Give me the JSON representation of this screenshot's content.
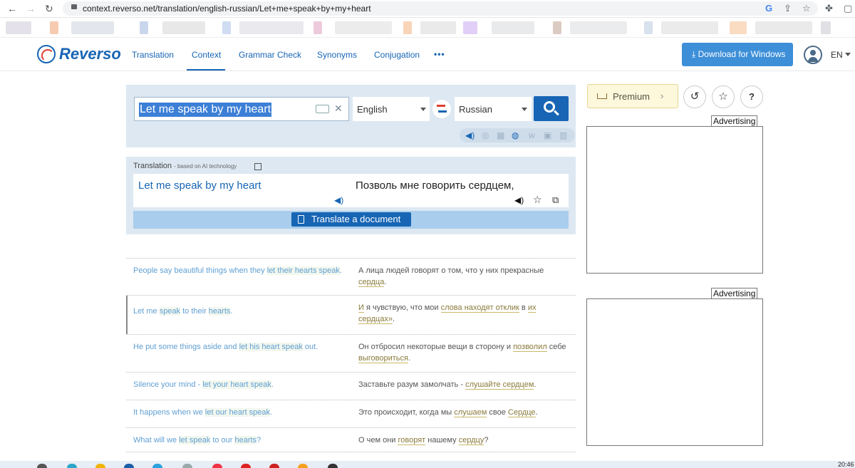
{
  "browser": {
    "url": "context.reverso.net/translation/english-russian/Let+me+speak+by+my+heart",
    "back_icon": "←",
    "forward_icon": "→",
    "reload_icon": "↻",
    "google_icon": "G",
    "share_icon": "⇪",
    "star_icon": "☆",
    "extensions_icon": "✤",
    "window_icon": "▢"
  },
  "header": {
    "logo": "Reverso",
    "nav": [
      "Translation",
      "Context",
      "Grammar Check",
      "Synonyms",
      "Conjugation"
    ],
    "active_nav": "Context",
    "more": "•••",
    "download_button": "Download for Windows",
    "language": "EN"
  },
  "search": {
    "query": "Let me speak by my heart",
    "source_lang": "English",
    "target_lang": "Russian"
  },
  "translation": {
    "label": "Translation",
    "sublabel": "- based on AI technology",
    "source": "Let me speak by my heart",
    "target": "Позволь мне говорить сердцем,",
    "doc_button": "Translate a document"
  },
  "examples": [
    {
      "src": [
        [
          "People say beautiful things when they ",
          false
        ],
        [
          "let their hearts speak",
          true
        ],
        [
          ".",
          false
        ]
      ],
      "tgt": [
        [
          "А лица людей говорят о том, что у них прекрасные ",
          false
        ],
        [
          "сердца",
          true
        ],
        [
          ".",
          false
        ]
      ]
    },
    {
      "src": [
        [
          "Let me ",
          false
        ],
        [
          "speak",
          true
        ],
        [
          " to their ",
          false
        ],
        [
          "hearts",
          true
        ],
        [
          ".",
          false
        ]
      ],
      "tgt": [
        [
          "И",
          true
        ],
        [
          " я чувствую, что мои ",
          false
        ],
        [
          "слова находят отклик",
          true
        ],
        [
          " в ",
          false
        ],
        [
          "их сердцах»",
          true
        ],
        [
          ".",
          false
        ]
      ]
    },
    {
      "src": [
        [
          "He put some things aside and ",
          false
        ],
        [
          "let his heart speak",
          true
        ],
        [
          " out.",
          false
        ]
      ],
      "tgt": [
        [
          "Он отбросил некоторые вещи в сторону и ",
          false
        ],
        [
          "позволил",
          true
        ],
        [
          " себе ",
          false
        ],
        [
          "выговориться",
          true
        ],
        [
          ".",
          false
        ]
      ]
    },
    {
      "src": [
        [
          "Silence your mind - ",
          false
        ],
        [
          "let your heart speak",
          true
        ],
        [
          ".",
          false
        ]
      ],
      "tgt": [
        [
          "Заставьте разум замолчать - ",
          false
        ],
        [
          "слушайте сердцем",
          true
        ],
        [
          ".",
          false
        ]
      ]
    },
    {
      "src": [
        [
          "It happens when we ",
          false
        ],
        [
          "let our heart speak",
          true
        ],
        [
          ".",
          false
        ]
      ],
      "tgt": [
        [
          "Это происходит, когда мы ",
          false
        ],
        [
          "слушаем",
          true
        ],
        [
          " свое ",
          false
        ],
        [
          "Сердце",
          true
        ],
        [
          ".",
          false
        ]
      ]
    },
    {
      "src": [
        [
          "What will we ",
          false
        ],
        [
          "let speak",
          true
        ],
        [
          " to our ",
          false
        ],
        [
          "hearts",
          true
        ],
        [
          "?",
          false
        ]
      ],
      "tgt": [
        [
          "О чем они ",
          false
        ],
        [
          "говорят",
          true
        ],
        [
          " нашему ",
          false
        ],
        [
          "сердцу",
          true
        ],
        [
          "?",
          false
        ]
      ]
    }
  ],
  "sidebar": {
    "premium": "Premium",
    "premium_arrow": "›",
    "history_icon": "↺",
    "favorites_icon": "☆",
    "help_icon": "?",
    "ad_label": "Advertising"
  },
  "taskbar": {
    "time": "20:46"
  },
  "colors": {
    "brand": "#1765b4",
    "accent_red": "#e0402f",
    "panel_bg": "#dde8f2"
  }
}
